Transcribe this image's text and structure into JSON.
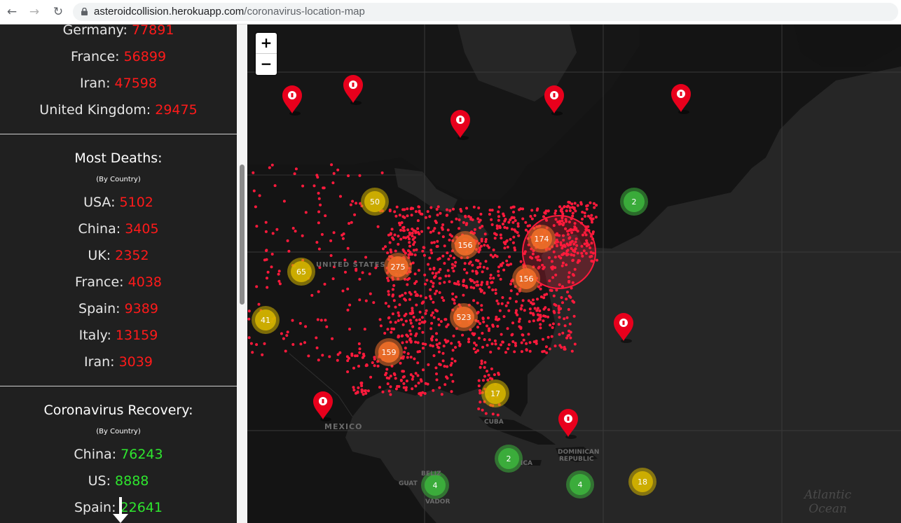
{
  "browser": {
    "url_domain": "asteroidcollision.herokuapp.com",
    "url_path": "/coronavirus-location-map"
  },
  "sidebar": {
    "cases_rows": [
      {
        "country": "Germany:",
        "value": "77891"
      },
      {
        "country": "France:",
        "value": "56899"
      },
      {
        "country": "Iran:",
        "value": "47598"
      },
      {
        "country": "United Kingdom:",
        "value": "29475"
      }
    ],
    "deaths": {
      "heading": "Most Deaths:",
      "subheading": "(By Country)",
      "rows": [
        {
          "country": "USA:",
          "value": "5102"
        },
        {
          "country": "China:",
          "value": "3405"
        },
        {
          "country": "UK:",
          "value": "2352"
        },
        {
          "country": "France:",
          "value": "4038"
        },
        {
          "country": "Spain:",
          "value": "9389"
        },
        {
          "country": "Italy:",
          "value": "13159"
        },
        {
          "country": "Iran:",
          "value": "3039"
        }
      ]
    },
    "recovery": {
      "heading": "Coronavirus Recovery:",
      "subheading": "(By Country)",
      "rows": [
        {
          "country": "China:",
          "value": "76243"
        },
        {
          "country": "US:",
          "value": "8888"
        },
        {
          "country": "Spain:",
          "value": "22641"
        }
      ]
    }
  },
  "map": {
    "zoom_in_label": "+",
    "zoom_out_label": "−",
    "labels": {
      "united_states": "UNITED STATES",
      "mexico": "MEXICO",
      "cuba": "CUBA",
      "dominican_republic_1": "DOMINICAN",
      "dominican_republic_2": "REPUBLIC",
      "guatemala": "GUAT",
      "belize": "BELIZ",
      "el_salvador": "VADOR",
      "jamaica": "ICA",
      "ocean_1": "Atlantic",
      "ocean_2": "Ocean"
    },
    "clusters": [
      {
        "count": "50",
        "level": "medium"
      },
      {
        "count": "2",
        "level": "low"
      },
      {
        "count": "156",
        "level": "high"
      },
      {
        "count": "174",
        "level": "high"
      },
      {
        "count": "65",
        "level": "medium"
      },
      {
        "count": "275",
        "level": "high"
      },
      {
        "count": "156",
        "level": "high"
      },
      {
        "count": "41",
        "level": "medium"
      },
      {
        "count": "523",
        "level": "high"
      },
      {
        "count": "159",
        "level": "high"
      },
      {
        "count": "17",
        "level": "medium"
      },
      {
        "count": "2",
        "level": "low"
      },
      {
        "count": "4",
        "level": "low"
      },
      {
        "count": "4",
        "level": "low"
      },
      {
        "count": "18",
        "level": "medium"
      }
    ],
    "marker_icon": "info-pin-icon",
    "colors": {
      "cases": "#ff1a1a",
      "recovered": "#2ee62e",
      "cluster_low": "#3cb33c",
      "cluster_medium": "#d4b400",
      "cluster_high": "#f06e28",
      "points": "#ff1a3c"
    }
  }
}
